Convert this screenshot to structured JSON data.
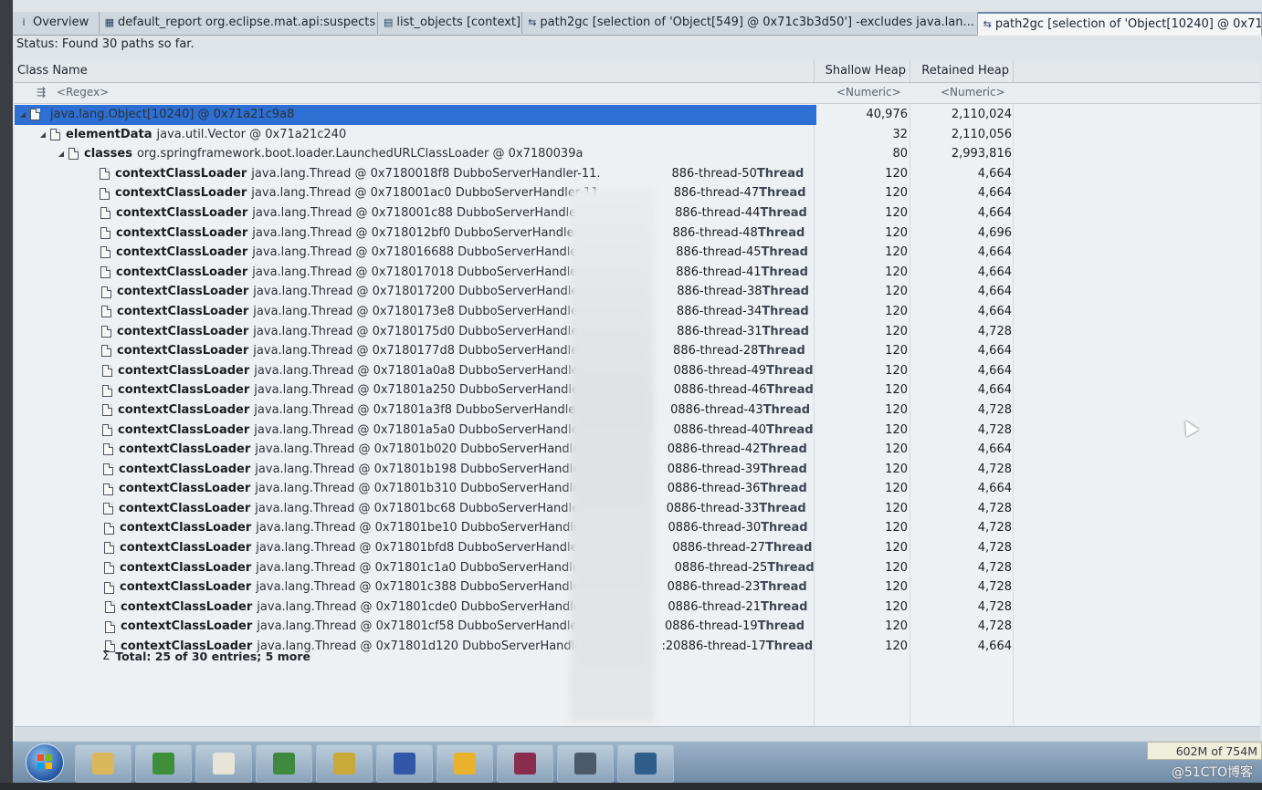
{
  "tabs": [
    {
      "label": "Overview",
      "icon": "info-icon"
    },
    {
      "label": "default_report  org.eclipse.mat.api:suspects",
      "icon": "report-icon"
    },
    {
      "label": "list_objects [context]",
      "icon": "list-icon"
    },
    {
      "label": "path2gc [selection of 'Object[549] @ 0x71c3b3d50'] -excludes java.lan...",
      "icon": "path-icon"
    },
    {
      "label": "path2gc [selection of 'Object[10240] @ 0x71...",
      "icon": "path-icon"
    }
  ],
  "status": "Status:  Found 30 paths so far.",
  "columns": {
    "class_name": "Class Name",
    "shallow": "Shallow Heap",
    "retained": "Retained Heap"
  },
  "filters": {
    "regex": "<Regex>",
    "numeric1": "<Numeric>",
    "numeric2": "<Numeric>"
  },
  "rows": [
    {
      "field": "",
      "type": "java.lang.Object[10240] @ 0x71a21c9a8",
      "thread": "",
      "shallow": "40,976",
      "retained": "2,110,024"
    },
    {
      "field": "elementData",
      "type": "java.util.Vector @ 0x71a21c240",
      "thread": "",
      "shallow": "32",
      "retained": "2,110,056"
    },
    {
      "field": "classes",
      "type": "org.springframework.boot.loader.LaunchedURLClassLoader @ 0x7180039a",
      "thread": "",
      "shallow": "80",
      "retained": "2,993,816"
    },
    {
      "field": "contextClassLoader",
      "type": "java.lang.Thread @ 0x7180018f8  DubboServerHandler-11.",
      "thread": "886-thread-50",
      "shallow": "120",
      "retained": "4,664"
    },
    {
      "field": "contextClassLoader",
      "type": "java.lang.Thread @ 0x718001ac0  DubboServerHandler-11.",
      "thread": "886-thread-47",
      "shallow": "120",
      "retained": "4,664"
    },
    {
      "field": "contextClassLoader",
      "type": "java.lang.Thread @ 0x718001c88  DubboServerHandler-11.",
      "thread": "886-thread-44",
      "shallow": "120",
      "retained": "4,664"
    },
    {
      "field": "contextClassLoader",
      "type": "java.lang.Thread @ 0x718012bf0  DubboServerHandler-11.",
      "thread": "886-thread-48",
      "shallow": "120",
      "retained": "4,696"
    },
    {
      "field": "contextClassLoader",
      "type": "java.lang.Thread @ 0x718016688  DubboServerHandler-11.",
      "thread": "886-thread-45",
      "shallow": "120",
      "retained": "4,664"
    },
    {
      "field": "contextClassLoader",
      "type": "java.lang.Thread @ 0x718017018  DubboServerHandler-11.",
      "thread": "886-thread-41",
      "shallow": "120",
      "retained": "4,664"
    },
    {
      "field": "contextClassLoader",
      "type": "java.lang.Thread @ 0x718017200  DubboServerHandler-11.",
      "thread": "886-thread-38",
      "shallow": "120",
      "retained": "4,664"
    },
    {
      "field": "contextClassLoader",
      "type": "java.lang.Thread @ 0x7180173e8  DubboServerHandler-11.",
      "thread": "886-thread-34",
      "shallow": "120",
      "retained": "4,664"
    },
    {
      "field": "contextClassLoader",
      "type": "java.lang.Thread @ 0x7180175d0  DubboServerHandler-11.",
      "thread": "886-thread-31",
      "shallow": "120",
      "retained": "4,728"
    },
    {
      "field": "contextClassLoader",
      "type": "java.lang.Thread @ 0x7180177d8  DubboServerHandler-11",
      "thread": "886-thread-28",
      "shallow": "120",
      "retained": "4,664"
    },
    {
      "field": "contextClassLoader",
      "type": "java.lang.Thread @ 0x71801a0a8  DubboServerHandler-11",
      "thread": "0886-thread-49",
      "shallow": "120",
      "retained": "4,664"
    },
    {
      "field": "contextClassLoader",
      "type": "java.lang.Thread @ 0x71801a250  DubboServerHandler-11",
      "thread": "0886-thread-46",
      "shallow": "120",
      "retained": "4,664"
    },
    {
      "field": "contextClassLoader",
      "type": "java.lang.Thread @ 0x71801a3f8  DubboServerHandler-11",
      "thread": "0886-thread-43",
      "shallow": "120",
      "retained": "4,728"
    },
    {
      "field": "contextClassLoader",
      "type": "java.lang.Thread @ 0x71801a5a0  DubboServerHandler-11",
      "thread": "0886-thread-40",
      "shallow": "120",
      "retained": "4,728"
    },
    {
      "field": "contextClassLoader",
      "type": "java.lang.Thread @ 0x71801b020  DubboServerHandler-1",
      "thread": "0886-thread-42",
      "shallow": "120",
      "retained": "4,664"
    },
    {
      "field": "contextClassLoader",
      "type": "java.lang.Thread @ 0x71801b198  DubboServerHandler-1",
      "thread": "0886-thread-39",
      "shallow": "120",
      "retained": "4,728"
    },
    {
      "field": "contextClassLoader",
      "type": "java.lang.Thread @ 0x71801b310  DubboServerHandler-1",
      "thread": "0886-thread-36",
      "shallow": "120",
      "retained": "4,664"
    },
    {
      "field": "contextClassLoader",
      "type": "java.lang.Thread @ 0x71801bc68  DubboServerHandler-1",
      "thread": "0886-thread-33",
      "shallow": "120",
      "retained": "4,728"
    },
    {
      "field": "contextClassLoader",
      "type": "java.lang.Thread @ 0x71801be10  DubboServerHandler-1",
      "thread": "0886-thread-30",
      "shallow": "120",
      "retained": "4,728"
    },
    {
      "field": "contextClassLoader",
      "type": "java.lang.Thread @ 0x71801bfd8  DubboServerHandler-11",
      "thread": "0886-thread-27",
      "shallow": "120",
      "retained": "4,728"
    },
    {
      "field": "contextClassLoader",
      "type": "java.lang.Thread @ 0x71801c1a0  DubboServerHandler-11",
      "thread": "0886-thread-25",
      "shallow": "120",
      "retained": "4,728"
    },
    {
      "field": "contextClassLoader",
      "type": "java.lang.Thread @ 0x71801c388  DubboServerHandler-1",
      "thread": "0886-thread-23",
      "shallow": "120",
      "retained": "4,728"
    },
    {
      "field": "contextClassLoader",
      "type": "java.lang.Thread @ 0x71801cde0  DubboServerHandler-1",
      "thread": "0886-thread-21",
      "shallow": "120",
      "retained": "4,728"
    },
    {
      "field": "contextClassLoader",
      "type": "java.lang.Thread @ 0x71801cf58  DubboServerHandler-1",
      "thread": "0886-thread-19",
      "shallow": "120",
      "retained": "4,728"
    },
    {
      "field": "contextClassLoader",
      "type": "java.lang.Thread @ 0x71801d120  DubboServerHandler-",
      "thread": ":20886-thread-17",
      "shallow": "120",
      "retained": "4,664"
    }
  ],
  "thread_word": "Thread",
  "total": "Total: 25 of 30 entries; 5 more",
  "memory": "602M of 754M",
  "watermark": "@51CTO博客",
  "taskbar_icons": [
    "folder-icon",
    "ie-icon",
    "document-icon",
    "excel-icon",
    "chart-icon",
    "network-icon",
    "java-icon",
    "database-icon",
    "console-icon",
    "db-search-icon"
  ],
  "colors": {
    "selection": "#2d6fd3",
    "header": "#e4e8eb",
    "taskbar": "#7f99b3"
  }
}
